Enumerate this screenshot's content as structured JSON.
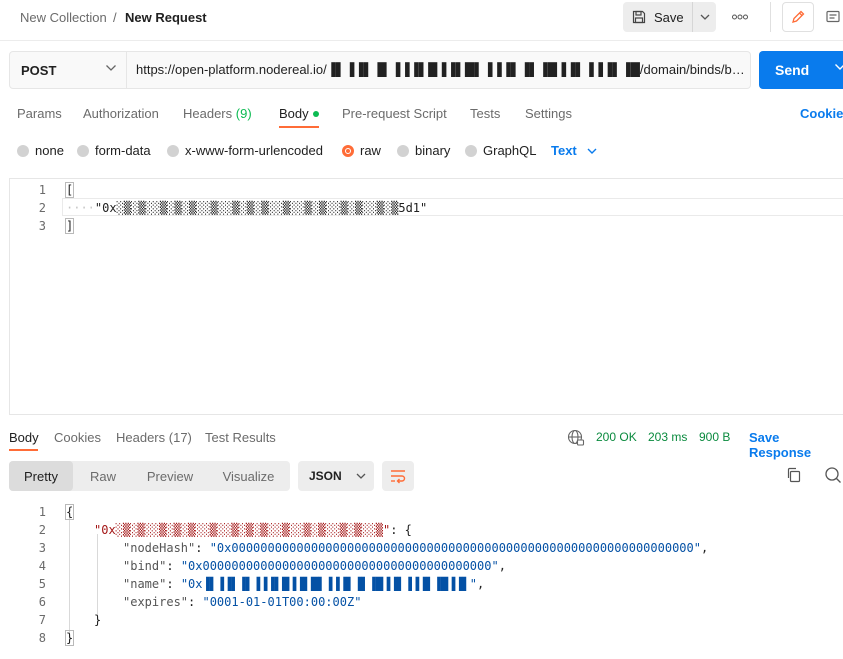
{
  "header": {
    "collection": "New Collection",
    "separator": "/",
    "request_name": "New Request",
    "save_label": "Save"
  },
  "request": {
    "method": "POST",
    "url": "https://open-platform.nodereal.io/▐▌▐▐▌▐▌▐▐▐▌█▐▐▌█▌▐▐▐▌▐▌▐█▐▐▌▐▐▐▌▐█/domain/binds/byNames",
    "send_label": "Send"
  },
  "request_tabs": [
    {
      "label": "Params",
      "count": ""
    },
    {
      "label": "Authorization",
      "count": ""
    },
    {
      "label": "Headers",
      "count": "(9)"
    },
    {
      "label": "Body",
      "count": ""
    },
    {
      "label": "Pre-request Script",
      "count": ""
    },
    {
      "label": "Tests",
      "count": ""
    },
    {
      "label": "Settings",
      "count": ""
    }
  ],
  "cookies_link": "Cookies",
  "body_types": [
    "none",
    "form-data",
    "x-www-form-urlencoded",
    "raw",
    "binary",
    "GraphQL"
  ],
  "body_text_format": "Text",
  "request_body": {
    "line_numbers": [
      "1",
      "2",
      "3"
    ],
    "lines": [
      "[",
      "\"0x░▒░▒░░▒░▒░▒░░▒░░▒░▒░▒░░▒░░▒░▒░░▒░▒░░▒░▒5d1\"",
      "]"
    ]
  },
  "response_tabs": [
    {
      "label": "Body"
    },
    {
      "label": "Cookies"
    },
    {
      "label": "Headers",
      "count": "(17)"
    },
    {
      "label": "Test Results"
    }
  ],
  "response_status": {
    "code": "200 OK",
    "time": "203 ms",
    "size": "900 B",
    "save_response": "Save Response"
  },
  "response_views": [
    "Pretty",
    "Raw",
    "Preview",
    "Visualize"
  ],
  "response_format": "JSON",
  "response_body": {
    "line_numbers": [
      "1",
      "2",
      "3",
      "4",
      "5",
      "6",
      "7",
      "8"
    ],
    "brace_open": "{",
    "brace_close": "}",
    "outer_key": "\"0x░▒░▒░░▒░▒░▒░░▒░░▒░▒░▒░░▒░░▒░▒░░▒░▒░░▒\"",
    "outer_sep": ": {",
    "inner_close": "}",
    "fields": [
      {
        "key": "\"nodeHash\"",
        "value": "\"0x0000000000000000000000000000000000000000000000000000000000000000\"",
        "trail": ","
      },
      {
        "key": "\"bind\"",
        "value": "\"0x0000000000000000000000000000000000000000\"",
        "trail": ","
      },
      {
        "key": "\"name\"",
        "value": "\"0x▐▌▐▐▌▐▌▐▐▐▌█▐▐▌█▌▐▐▐▌▐▌▐█▐▐▌▐▐▐▌▐█▐▐▌\"",
        "trail": ","
      },
      {
        "key": "\"expires\"",
        "value": "\"0001-01-01T00:00:00Z\"",
        "trail": ""
      }
    ]
  },
  "colors": {
    "accent_orange": "#ff6c37",
    "send_blue": "#097bed",
    "status_green": "#0cbb52"
  },
  "icons": [
    "save-icon",
    "chevron-down-icon",
    "more-icon",
    "edit-icon",
    "comment-icon",
    "globe-icon",
    "wrap-icon",
    "copy-icon",
    "search-icon"
  ]
}
